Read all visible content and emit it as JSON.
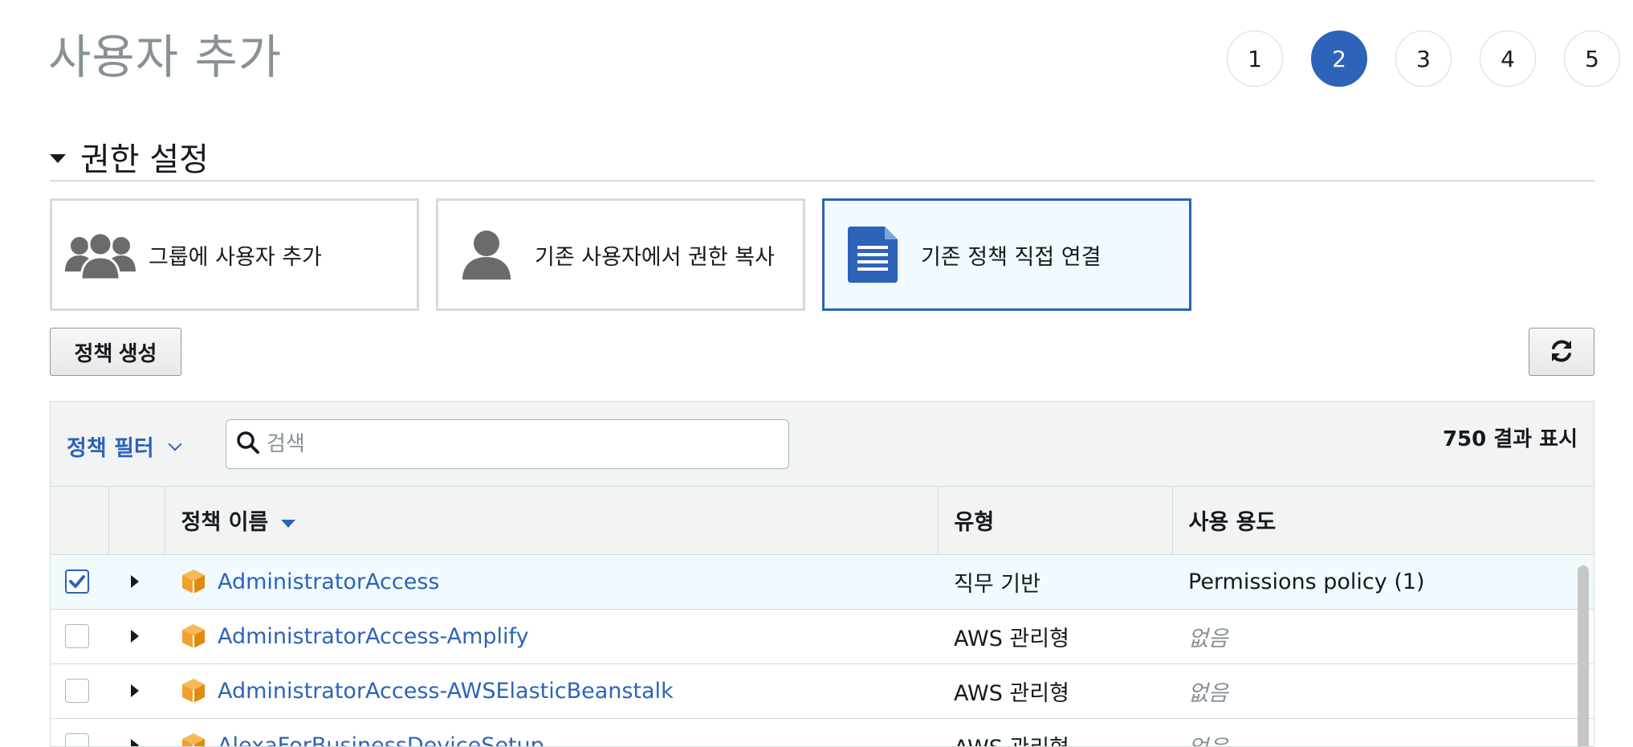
{
  "page": {
    "title": "사용자 추가"
  },
  "steps": [
    "1",
    "2",
    "3",
    "4",
    "5"
  ],
  "active_step": "2",
  "section": {
    "title": "권한 설정"
  },
  "options": [
    {
      "label": "그룹에 사용자 추가",
      "icon": "group-icon",
      "selected": false
    },
    {
      "label": "기존 사용자에서 권한 복사",
      "icon": "user-icon",
      "selected": false
    },
    {
      "label": "기존 정책 직접 연결",
      "icon": "document-icon",
      "selected": true
    }
  ],
  "toolbar": {
    "create_policy_label": "정책 생성"
  },
  "table": {
    "filter_label": "정책 필터",
    "search_placeholder": "검색",
    "result_count": "750 결과 표시",
    "columns": {
      "name": "정책 이름",
      "type": "유형",
      "usage": "사용 용도"
    },
    "rows": [
      {
        "name": "AdministratorAccess",
        "type": "직무 기반",
        "usage": "Permissions policy (1)",
        "checked": true
      },
      {
        "name": "AdministratorAccess-Amplify",
        "type": "AWS 관리형",
        "usage": "없음",
        "checked": false
      },
      {
        "name": "AdministratorAccess-AWSElasticBeanstalk",
        "type": "AWS 관리형",
        "usage": "없음",
        "checked": false
      },
      {
        "name": "AlexaForBusinessDeviceSetup",
        "type": "AWS 관리형",
        "usage": "없음",
        "checked": false
      }
    ]
  },
  "colors": {
    "accent": "#2d63b8",
    "policy_icon": "#f0a030",
    "selected_bg": "#f1faff"
  }
}
